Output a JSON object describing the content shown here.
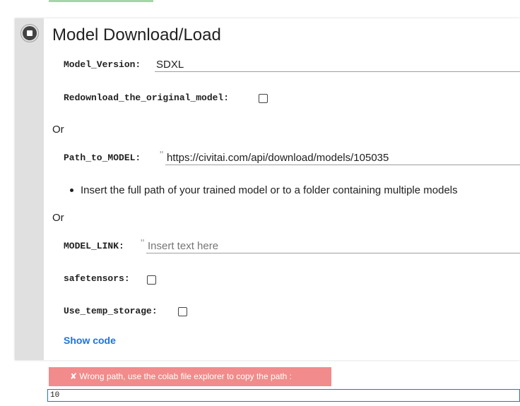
{
  "cell": {
    "title": "Model Download/Load",
    "show_code_label": "Show code",
    "or_text_1": "Or",
    "or_text_2": "Or",
    "fields": {
      "model_version": {
        "label": "Model_Version:",
        "value": "SDXL"
      },
      "redownload": {
        "label": "Redownload_the_original_model:",
        "checked": false
      },
      "path_to_model": {
        "label": "Path_to_MODEL:",
        "quote": "\"",
        "value": "https://civitai.com/api/download/models/105035"
      },
      "path_hint": "Insert the full path of your trained model or to a folder containing multiple models",
      "model_link": {
        "label": "MODEL_LINK:",
        "quote": "\"",
        "placeholder": "Insert text here"
      },
      "safetensors": {
        "label": "safetensors:",
        "checked": false
      },
      "use_temp_storage": {
        "label": "Use_temp_storage:",
        "checked": false
      }
    }
  },
  "output": {
    "error_text": "✘ Wrong path, use the colab file explorer to copy the path :",
    "input_value": "10"
  },
  "colors": {
    "accent": "#1a73e8",
    "error": "#f28b8b",
    "gutter": "#e0e0e0",
    "success_bar": "#a5d6a7"
  }
}
